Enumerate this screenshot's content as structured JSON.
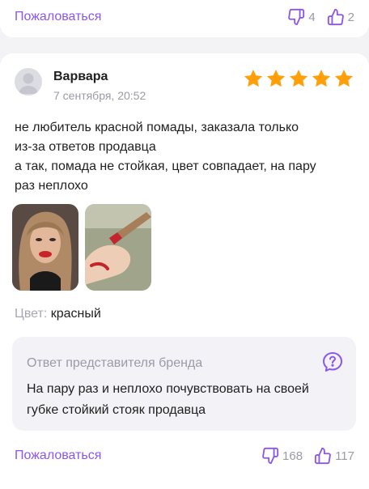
{
  "previous_review": {
    "complain_label": "Пожаловаться",
    "dislikes": "4",
    "likes": "2"
  },
  "review": {
    "author": "Варвара",
    "date": "7 сентября, 20:52",
    "rating": 5,
    "rating_max": 5,
    "text_lines": [
      "не любитель красной помады, заказала только",
      "из-за ответов продавца",
      "а так, помада не стойкая, цвет совпадает, на пару",
      "раз неплохо"
    ],
    "color_label": "Цвет:",
    "color_value": "красный",
    "brand_reply": {
      "title": "Ответ представителя бренда",
      "text_lines": [
        "На пару раз и неплохо почувствовать на своей",
        "губке стойкий стояк продавца"
      ]
    },
    "complain_label": "Пожаловаться",
    "dislikes": "168",
    "likes": "117"
  },
  "colors": {
    "accent": "#8b56f0",
    "star": "#ff9f0a",
    "muted": "#9a9aa8"
  }
}
